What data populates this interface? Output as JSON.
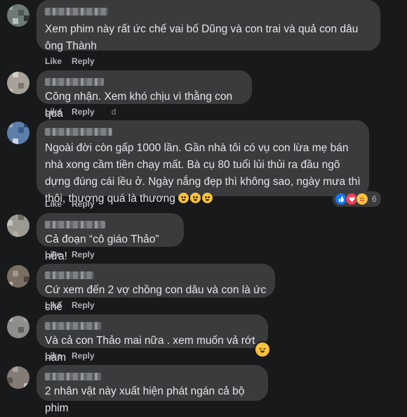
{
  "actions": {
    "like": "Like",
    "reply": "Reply"
  },
  "comments": [
    {
      "text": "Xem phim này rất ức chế vai bố Dũng và con trai và quả con dâu ông Thành",
      "extra": ""
    },
    {
      "text": "Công nhận. Xem khó chịu vì thằng con quá",
      "extra": "d"
    },
    {
      "text": "Ngoài đời còn gấp 1000 lần. Gần nhà tôi có vụ con lừa mẹ bán nhà xong cầm tiền chạy mất. Bà cụ 80 tuổi lủi thủi ra đầu ngõ dựng đúng cái lều ở. Ngày nắng đẹp thì không sao, ngày mưa thì thôi, thương quá là thương",
      "extra": "",
      "reaction_count": "6",
      "reaction_icons": [
        "like-icon",
        "love-icon",
        "care-icon"
      ]
    },
    {
      "text": "Cả đoạn “cô giáo Thảo” nữa!",
      "extra": ""
    },
    {
      "text": "Cứ xem đến 2 vợ chồng con dâu và con là ức chế",
      "extra": ""
    },
    {
      "text": "Và cả con Thảo mai nữa . xem muốn vả rớt hàm",
      "extra": ""
    },
    {
      "text": "2 nhân vật này xuất hiện phát ngán cả bộ phim",
      "extra": ""
    }
  ],
  "colors": {
    "background": "#18191a",
    "bubble": "#3a3b3c",
    "text": "#e4e6eb",
    "secondary": "#b0b3b8",
    "like_blue": "#1877f2",
    "love_red": "#f33e58"
  }
}
